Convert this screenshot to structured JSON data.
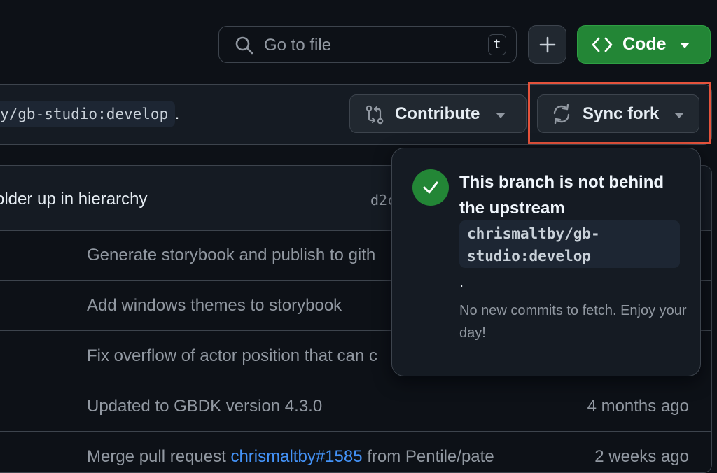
{
  "top_bar": {
    "search_placeholder": "Go to file",
    "search_shortcut": "t",
    "add_icon": "plus-icon",
    "code_label": "Code",
    "code_icon": "code-icon"
  },
  "fork_bar": {
    "branch_ref": "y/gb-studio:develop",
    "period": ".",
    "contribute_label": "Contribute",
    "contribute_icon": "git-compare-icon",
    "sync_label": "Sync fork",
    "sync_icon": "sync-icon"
  },
  "file_table": {
    "header": {
      "message": "older up in hierarchy",
      "sha": "d2c"
    },
    "rows": [
      {
        "message": "Generate storybook and publish to gith",
        "time": ""
      },
      {
        "message": "Add windows themes to storybook",
        "time": ""
      },
      {
        "message": "Fix overflow of actor position that can c",
        "time": ""
      },
      {
        "message": "Updated to GBDK version 4.3.0",
        "time": "4 months ago"
      },
      {
        "message_prefix": "Merge pull request ",
        "link": "chrismaltby#1585",
        "message_suffix": " from Pentile/pate",
        "time": "2 weeks ago"
      }
    ]
  },
  "popover": {
    "title": "This branch is not behind the upstream",
    "branch": "chrismaltby/gb-studio:develop",
    "period": ".",
    "description": "No new commits to fetch. Enjoy your day!"
  },
  "colors": {
    "background": "#0d1117",
    "accent_green": "#238636",
    "highlight_red": "#e5533c",
    "link_blue": "#4493f8"
  }
}
